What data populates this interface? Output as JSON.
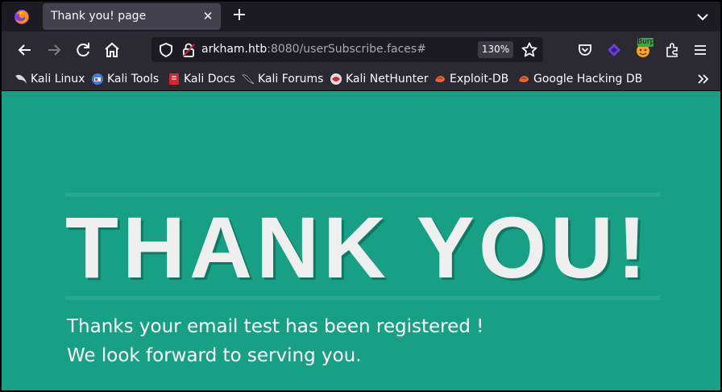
{
  "tab": {
    "title": "Thank you! page",
    "close_symbol": "✕"
  },
  "tabstrip": {
    "new_tab_symbol": "+",
    "app_icon": "firefox-icon",
    "list_tabs_icon": "chevron-down-icon"
  },
  "navbar": {
    "url_host": "arkham.htb",
    "url_rest": ":8080/userSubscribe.faces#",
    "zoom": "130%",
    "icons": [
      "back-icon",
      "forward-icon",
      "reload-icon",
      "home-icon",
      "shield-icon",
      "lock-icon",
      "star-icon",
      "pocket-icon",
      "extension-purple-icon",
      "burp-icon",
      "extensions-icon",
      "menu-icon"
    ],
    "burp_label": "Burp"
  },
  "bookmarks": [
    {
      "label": "Kali Linux",
      "icon": "kali-dragon-icon"
    },
    {
      "label": "Kali Tools",
      "icon": "kali-tools-icon"
    },
    {
      "label": "Kali Docs",
      "icon": "kali-docs-icon"
    },
    {
      "label": "Kali Forums",
      "icon": "kali-forums-icon"
    },
    {
      "label": "Kali NetHunter",
      "icon": "kali-nethunter-icon"
    },
    {
      "label": "Exploit-DB",
      "icon": "exploit-db-icon"
    },
    {
      "label": "Google Hacking DB",
      "icon": "ghdb-icon"
    }
  ],
  "page": {
    "heading": "THANK YOU!",
    "message_line1": "Thanks your email test has been registered !",
    "message_line2": "We look forward to serving you."
  },
  "colors": {
    "page_background": "#18a085",
    "heading_color": "#efefef",
    "browser_chrome": "#2b2a33"
  }
}
